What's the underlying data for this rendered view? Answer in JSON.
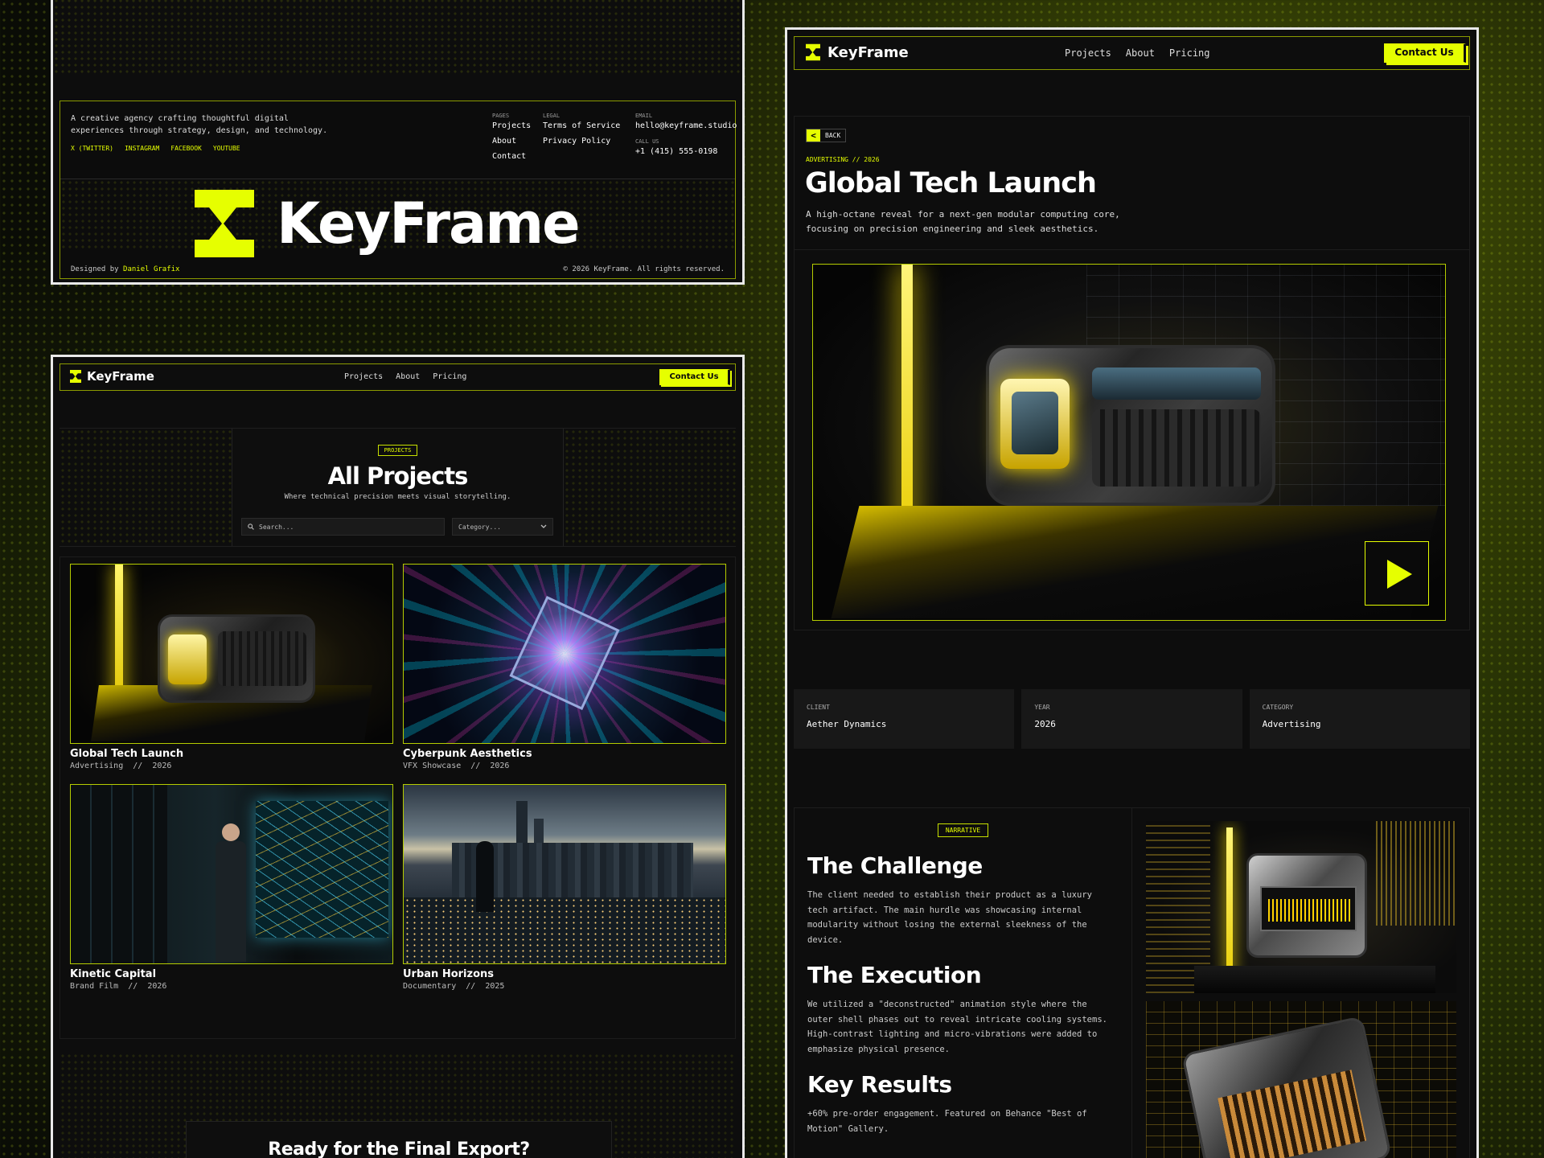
{
  "brand": {
    "name": "KeyFrame"
  },
  "nav": {
    "projects": "Projects",
    "about": "About",
    "pricing": "Pricing",
    "contact": "Contact Us"
  },
  "footer": {
    "about_line1": "A creative agency crafting thoughtful digital",
    "about_line2": "experiences through strategy, design, and technology.",
    "socials": [
      "X (TWITTER)",
      "INSTAGRAM",
      "FACEBOOK",
      "YOUTUBE"
    ],
    "pages_label": "PAGES",
    "pages": [
      "Projects",
      "About",
      "Contact"
    ],
    "legal_label": "LEGAL",
    "legal": [
      "Terms of Service",
      "Privacy Policy"
    ],
    "email_label": "EMAIL",
    "email": "hello@keyframe.studio",
    "call_label": "CALL US",
    "phone": "+1 (415) 555-0198",
    "big_brand": "KeyFrame",
    "designed_by": "Designed by",
    "designer": "Daniel Grafix",
    "copyright": "© 2026 KeyFrame. All rights reserved."
  },
  "projects_page": {
    "tag": "PROJECTS",
    "title": "All Projects",
    "subtitle": "Where technical precision meets visual storytelling.",
    "search_placeholder": "Search...",
    "category_placeholder": "Category...",
    "cards": [
      {
        "title": "Global Tech Launch",
        "meta": "Advertising  //  2026"
      },
      {
        "title": "Cyberpunk Aesthetics",
        "meta": "VFX Showcase  //  2026"
      },
      {
        "title": "Kinetic Capital",
        "meta": "Brand Film  //  2026"
      },
      {
        "title": "Urban Horizons",
        "meta": "Documentary  //  2025"
      }
    ],
    "cta_title": "Ready for the Final Export?"
  },
  "detail_page": {
    "back": "BACK",
    "kicker": "ADVERTISING // 2026",
    "title": "Global Tech Launch",
    "desc_line1": "A high-octane reveal for a next-gen modular computing core,",
    "desc_line2": "focusing on precision engineering and sleek aesthetics.",
    "stats": [
      {
        "label": "CLIENT",
        "value": "Aether Dynamics"
      },
      {
        "label": "YEAR",
        "value": "2026"
      },
      {
        "label": "CATEGORY",
        "value": "Advertising"
      }
    ],
    "narrative_tag": "NARRATIVE",
    "challenge_title": "The Challenge",
    "challenge_lines": [
      "The client needed to establish their product as a luxury",
      "tech artifact. The main hurdle was showcasing internal",
      "modularity without losing the external sleekness of the",
      "device."
    ],
    "execution_title": "The Execution",
    "execution_lines": [
      "We utilized a \"deconstructed\" animation style where the",
      "outer shell phases out to reveal intricate cooling systems.",
      "High-contrast lighting and micro-vibrations were added to",
      "emphasize physical presence."
    ],
    "results_title": "Key Results",
    "results_lines": [
      "+60% pre-order engagement. Featured on Behance \"Best of",
      "Motion\" Gallery."
    ]
  },
  "colors": {
    "accent": "#e6ff00",
    "panel": "#0d0d0d",
    "border": "#8b9b00"
  },
  "icons": [
    "logo-mark-icon",
    "search-icon",
    "chevron-down-icon",
    "back-arrow-icon",
    "play-icon"
  ]
}
